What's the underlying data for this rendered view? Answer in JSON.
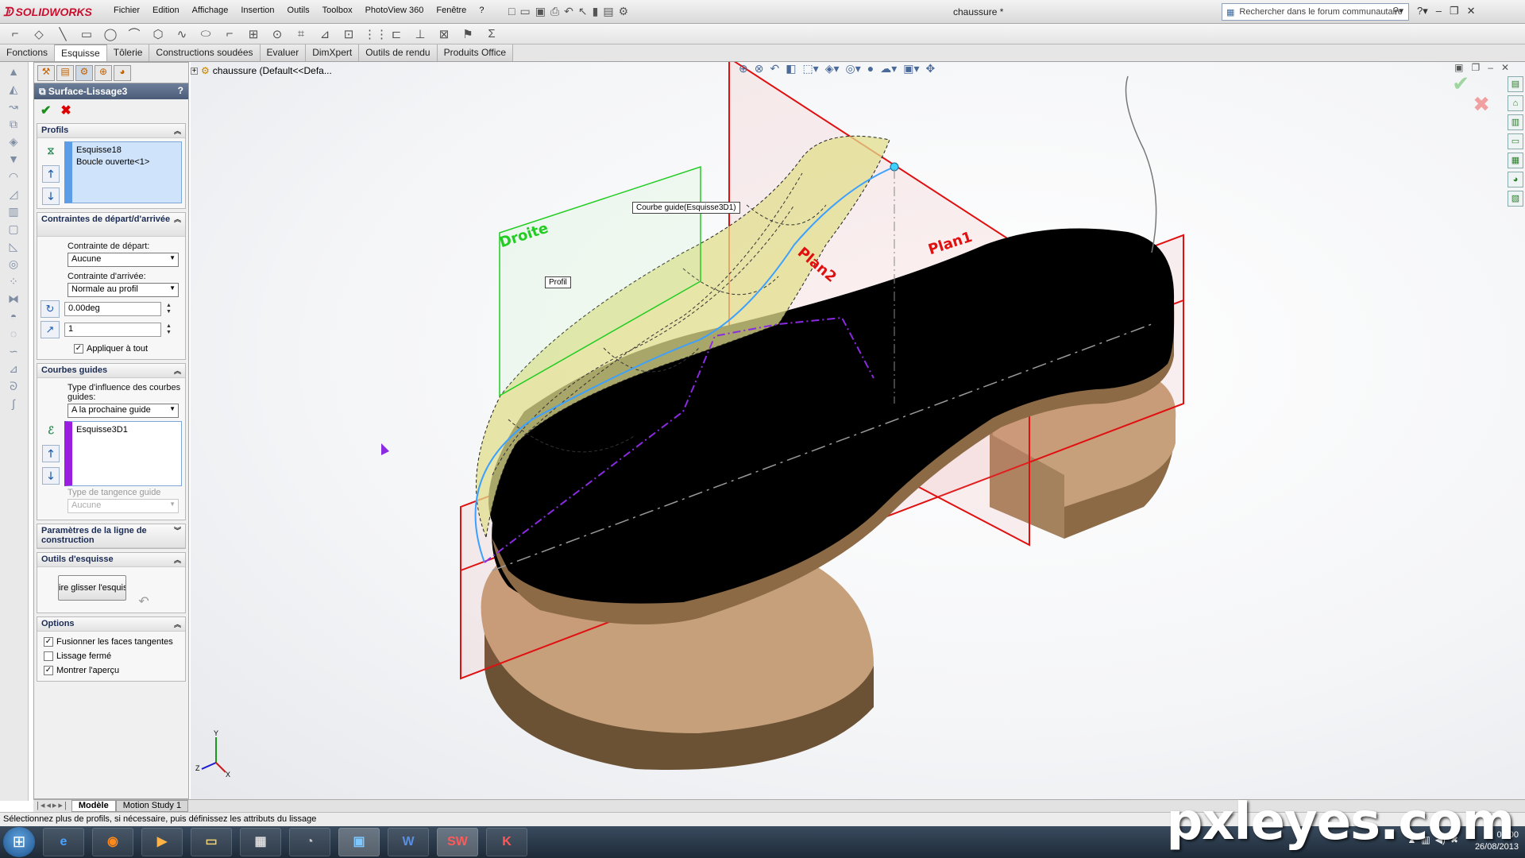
{
  "app": {
    "brand": "SOLIDWORKS",
    "menus": [
      "Fichier",
      "Edition",
      "Affichage",
      "Insertion",
      "Outils",
      "Toolbox",
      "PhotoView 360",
      "Fenêtre",
      "?"
    ],
    "document_title": "chaussure *",
    "search_placeholder": "Rechercher dans le forum communautaire"
  },
  "command_tabs": [
    {
      "label": "Fonctions",
      "active": false
    },
    {
      "label": "Esquisse",
      "active": true
    },
    {
      "label": "Tôlerie",
      "active": false
    },
    {
      "label": "Constructions soudées",
      "active": false
    },
    {
      "label": "Evaluer",
      "active": false
    },
    {
      "label": "DimXpert",
      "active": false
    },
    {
      "label": "Outils de rendu",
      "active": false
    },
    {
      "label": "Produits Office",
      "active": false
    }
  ],
  "property_manager": {
    "title": "Surface-Lissage3",
    "help": "?",
    "profils": {
      "heading": "Profils",
      "items": [
        "Esquisse18",
        "Boucle ouverte<1>"
      ]
    },
    "contraintes": {
      "heading": "Contraintes de départ/d'arrivée",
      "start_label": "Contrainte de départ:",
      "start_value": "Aucune",
      "end_label": "Contrainte d'arrivée:",
      "end_value": "Normale au profil",
      "angle_value": "0.00deg",
      "length_value": "1",
      "apply_all_label": "Appliquer à tout",
      "apply_all_checked": true
    },
    "courbes_guides": {
      "heading": "Courbes guides",
      "influence_label": "Type d'influence des courbes guides:",
      "influence_value": "A la prochaine guide",
      "items": [
        "Esquisse3D1"
      ],
      "tangency_label": "Type de tangence guide",
      "tangency_value": "Aucune"
    },
    "ligne_construction": {
      "heading": "Paramètres de la ligne de construction"
    },
    "outils_esquisse": {
      "heading": "Outils d'esquisse",
      "drag_button": "ire glisser l'esquis"
    },
    "options": {
      "heading": "Options",
      "items": [
        {
          "label": "Fusionner les faces tangentes",
          "checked": true
        },
        {
          "label": "Lissage fermé",
          "checked": false
        },
        {
          "label": "Montrer l'aperçu",
          "checked": true
        }
      ]
    }
  },
  "viewport": {
    "tree_root": "chaussure  (Default<<Defa...",
    "callouts": {
      "guide": "Courbe guide(Esquisse3D1)",
      "profile": "Profil"
    },
    "plane_labels": {
      "droite": "Droite",
      "plan2": "Plan2",
      "plan1": "Plan1"
    },
    "triad_axes": {
      "y": "Y",
      "z": "Z",
      "x": "X"
    }
  },
  "bottom_tabs": [
    "Modèle",
    "Motion Study 1"
  ],
  "status_text": "Sélectionnez plus de profils, si nécessaire, puis définissez les attributs du lissage",
  "taskbar": {
    "time": "09:00",
    "date": "26/08/2013"
  },
  "watermark": "pxleyes.com",
  "colors": {
    "plane_red": "#e01010",
    "plane_green": "#22cc22",
    "sole": "#000000",
    "heel": "#b89268",
    "guide_blue": "#3ba0ff",
    "profile_purple": "#8a2be2"
  }
}
